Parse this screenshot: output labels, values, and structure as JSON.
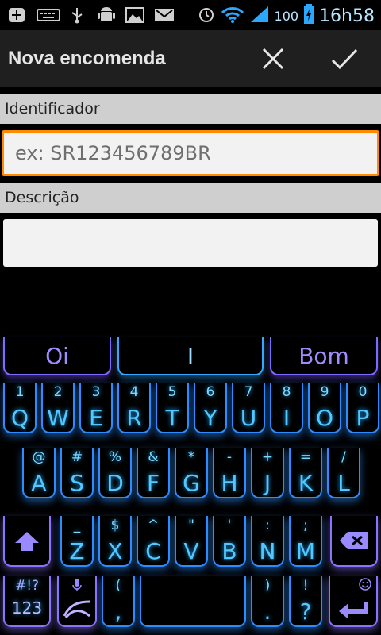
{
  "status": {
    "battery_percent": "100",
    "time": "16h58"
  },
  "actionbar": {
    "title": "Nova encomenda"
  },
  "form": {
    "identificador_label": "Identificador",
    "identificador_placeholder": "ex: SR123456789BR",
    "descricao_label": "Descrição",
    "descricao_value": ""
  },
  "keyboard": {
    "suggestions": [
      "Oi",
      "I",
      "Bom"
    ],
    "row1": [
      {
        "p": "Q",
        "s": "1"
      },
      {
        "p": "W",
        "s": "2"
      },
      {
        "p": "E",
        "s": "3"
      },
      {
        "p": "R",
        "s": "4"
      },
      {
        "p": "T",
        "s": "5"
      },
      {
        "p": "Y",
        "s": "6"
      },
      {
        "p": "U",
        "s": "7"
      },
      {
        "p": "I",
        "s": "8"
      },
      {
        "p": "O",
        "s": "9"
      },
      {
        "p": "P",
        "s": "0"
      }
    ],
    "row2": [
      {
        "p": "A",
        "s": "@"
      },
      {
        "p": "S",
        "s": "#"
      },
      {
        "p": "D",
        "s": "%"
      },
      {
        "p": "F",
        "s": "&"
      },
      {
        "p": "G",
        "s": "*"
      },
      {
        "p": "H",
        "s": "-"
      },
      {
        "p": "J",
        "s": "+"
      },
      {
        "p": "K",
        "s": "="
      },
      {
        "p": "L",
        "s": "/"
      }
    ],
    "row3": [
      {
        "p": "Z",
        "s": "_"
      },
      {
        "p": "X",
        "s": "$"
      },
      {
        "p": "C",
        "s": "^"
      },
      {
        "p": "V",
        "s": "\""
      },
      {
        "p": "B",
        "s": "'"
      },
      {
        "p": "N",
        "s": ":"
      },
      {
        "p": "M",
        "s": ";"
      }
    ],
    "bottom": {
      "symbols_top": "#!?",
      "symbols_main": "123",
      "comma_top": "(",
      "comma_main": ",",
      "period_top": ")",
      "period_main": ".",
      "question_top": "!",
      "question_main": "?"
    }
  },
  "colors": {
    "accent_orange": "#ff8a00",
    "keyboard_blue": "#2e8cff",
    "keyboard_purple": "#8a74ff"
  },
  "icons": [
    "add-icon",
    "keyboard-icon",
    "usb-icon",
    "android-icon",
    "image-icon",
    "gmail-icon",
    "alarm-icon",
    "wifi-icon",
    "signal-icon",
    "battery-charging-icon",
    "close-icon",
    "check-icon",
    "shift-icon",
    "backspace-icon",
    "mic-icon",
    "swype-icon",
    "smiley-icon",
    "enter-icon"
  ]
}
